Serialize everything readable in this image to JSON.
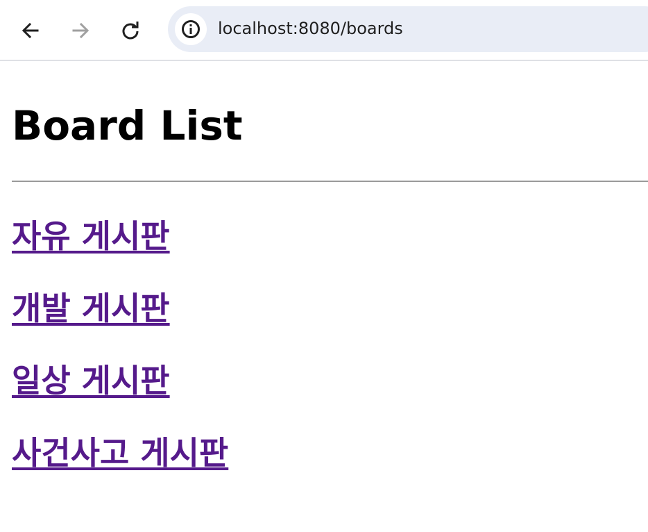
{
  "browser": {
    "url": "localhost:8080/boards",
    "back_icon": "arrow-left-icon",
    "forward_icon": "arrow-right-icon",
    "reload_icon": "reload-icon",
    "site_info_icon": "info-icon"
  },
  "page": {
    "title": "Board List",
    "boards": [
      {
        "label": "자유 게시판"
      },
      {
        "label": "개발 게시판"
      },
      {
        "label": "일상 게시판"
      },
      {
        "label": "사건사고 게시판"
      }
    ],
    "link_color": "#551a8b"
  }
}
